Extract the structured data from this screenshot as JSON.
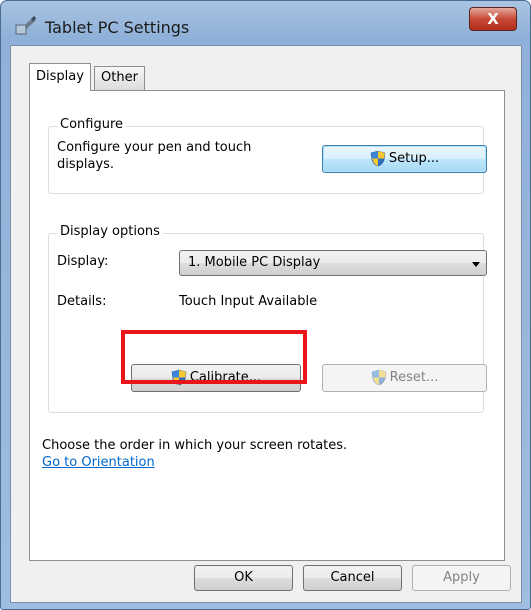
{
  "window": {
    "title": "Tablet PC Settings",
    "close_symbol": "X"
  },
  "tabs": [
    {
      "label": "Display",
      "selected": true
    },
    {
      "label": "Other",
      "selected": false
    }
  ],
  "configure": {
    "legend": "Configure",
    "description_line1": "Configure your pen and touch",
    "description_line2": "displays.",
    "setup_button": "Setup..."
  },
  "display_options": {
    "legend": "Display options",
    "display_label": "Display:",
    "display_selected": "1. Mobile PC Display",
    "details_label": "Details:",
    "details_value": "Touch Input Available",
    "calibrate_button": "Calibrate...",
    "reset_button": "Reset..."
  },
  "orientation": {
    "text": "Choose the order in which your screen rotates.",
    "link": "Go to Orientation"
  },
  "footer": {
    "ok": "OK",
    "cancel": "Cancel",
    "apply": "Apply"
  },
  "colors": {
    "highlight": "#e8161b",
    "link": "#0066cc",
    "close": "#c74a36"
  },
  "icons": [
    "tablet-pc-icon",
    "uac-shield-icon",
    "dropdown-arrow-icon",
    "close-icon"
  ]
}
